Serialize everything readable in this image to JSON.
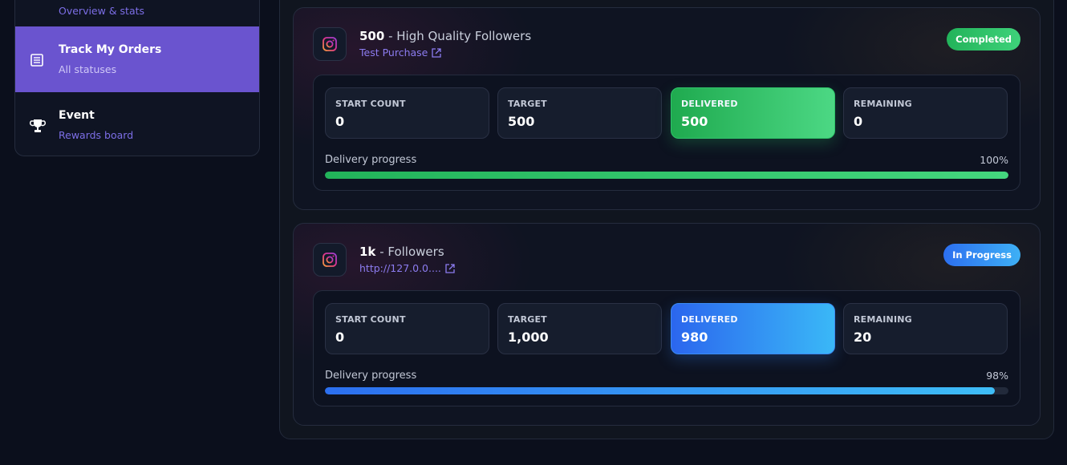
{
  "sidebar": {
    "items": [
      {
        "title": "",
        "subtitle": "Overview & stats",
        "icon": "dashboard-icon"
      },
      {
        "title": "Track My Orders",
        "subtitle": "All statuses",
        "icon": "list-icon",
        "active": true
      },
      {
        "title": "Event",
        "subtitle": "Rewards board",
        "icon": "trophy-icon"
      }
    ]
  },
  "orders": [
    {
      "quantity": "500",
      "service": " - High Quality Followers",
      "link": "Test Purchase",
      "status": "Completed",
      "stats": {
        "start_label": "START COUNT",
        "start_value": "0",
        "target_label": "TARGET",
        "target_value": "500",
        "delivered_label": "DELIVERED",
        "delivered_value": "500",
        "remaining_label": "REMAINING",
        "remaining_value": "0"
      },
      "progress_label": "Delivery progress",
      "progress_text": "100%",
      "progress": 100
    },
    {
      "quantity": "1k",
      "service": " - Followers",
      "link": "http://127.0.0....",
      "status": "In Progress",
      "stats": {
        "start_label": "START COUNT",
        "start_value": "0",
        "target_label": "TARGET",
        "target_value": "1,000",
        "delivered_label": "DELIVERED",
        "delivered_value": "980",
        "remaining_label": "REMAINING",
        "remaining_value": "20"
      },
      "progress_label": "Delivery progress",
      "progress_text": "98%",
      "progress": 98
    }
  ],
  "colors": {
    "accent": "#6a54cf",
    "completed": "#22b35a",
    "in_progress": "#2c6ff0",
    "link": "#8c7cf0"
  }
}
